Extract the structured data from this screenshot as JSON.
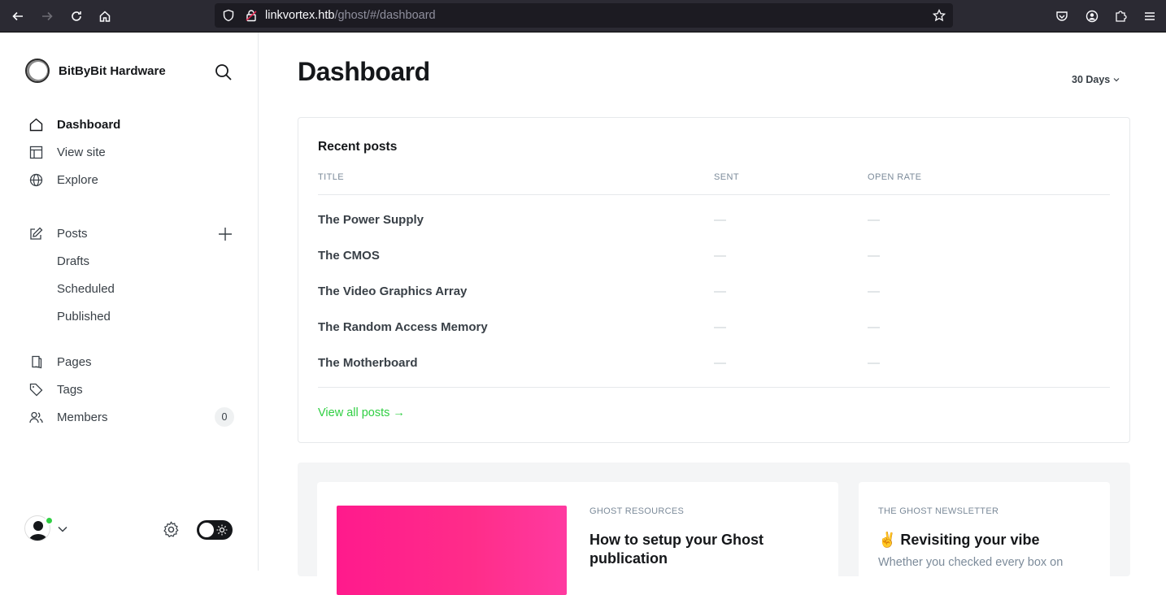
{
  "browser": {
    "url_host": "linkvortex.htb",
    "url_path": "/ghost/#/dashboard"
  },
  "sidebar": {
    "brand": "BitByBit Hardware",
    "nav": [
      {
        "label": "Dashboard",
        "icon": "home-icon",
        "active": true
      },
      {
        "label": "View site",
        "icon": "layout-icon"
      },
      {
        "label": "Explore",
        "icon": "globe-icon"
      }
    ],
    "posts": {
      "label": "Posts",
      "sub": [
        "Drafts",
        "Scheduled",
        "Published"
      ]
    },
    "more": [
      {
        "label": "Pages",
        "icon": "pages-icon"
      },
      {
        "label": "Tags",
        "icon": "tag-icon"
      },
      {
        "label": "Members",
        "icon": "members-icon",
        "count": "0"
      }
    ]
  },
  "main": {
    "title": "Dashboard",
    "range": "30 Days",
    "recent_posts": {
      "title": "Recent posts",
      "columns": [
        "TITLE",
        "SENT",
        "OPEN RATE"
      ],
      "rows": [
        {
          "title": "The Power Supply",
          "sent": "—",
          "open_rate": "—"
        },
        {
          "title": "The CMOS",
          "sent": "—",
          "open_rate": "—"
        },
        {
          "title": "The Video Graphics Array",
          "sent": "—",
          "open_rate": "—"
        },
        {
          "title": "The Random Access Memory",
          "sent": "—",
          "open_rate": "—"
        },
        {
          "title": "The Motherboard",
          "sent": "—",
          "open_rate": "—"
        }
      ],
      "view_all": "View all posts →"
    },
    "resources": {
      "left_tag": "GHOST RESOURCES",
      "left_title": "How to setup your Ghost publication",
      "right_tag": "THE GHOST NEWSLETTER",
      "right_title": "✌️ Revisiting your vibe",
      "right_sub": "Whether you checked every box on"
    }
  },
  "colors": {
    "accent": "#30cf43",
    "pink": "#ff1a8c",
    "chrome": "#2b2a33"
  }
}
